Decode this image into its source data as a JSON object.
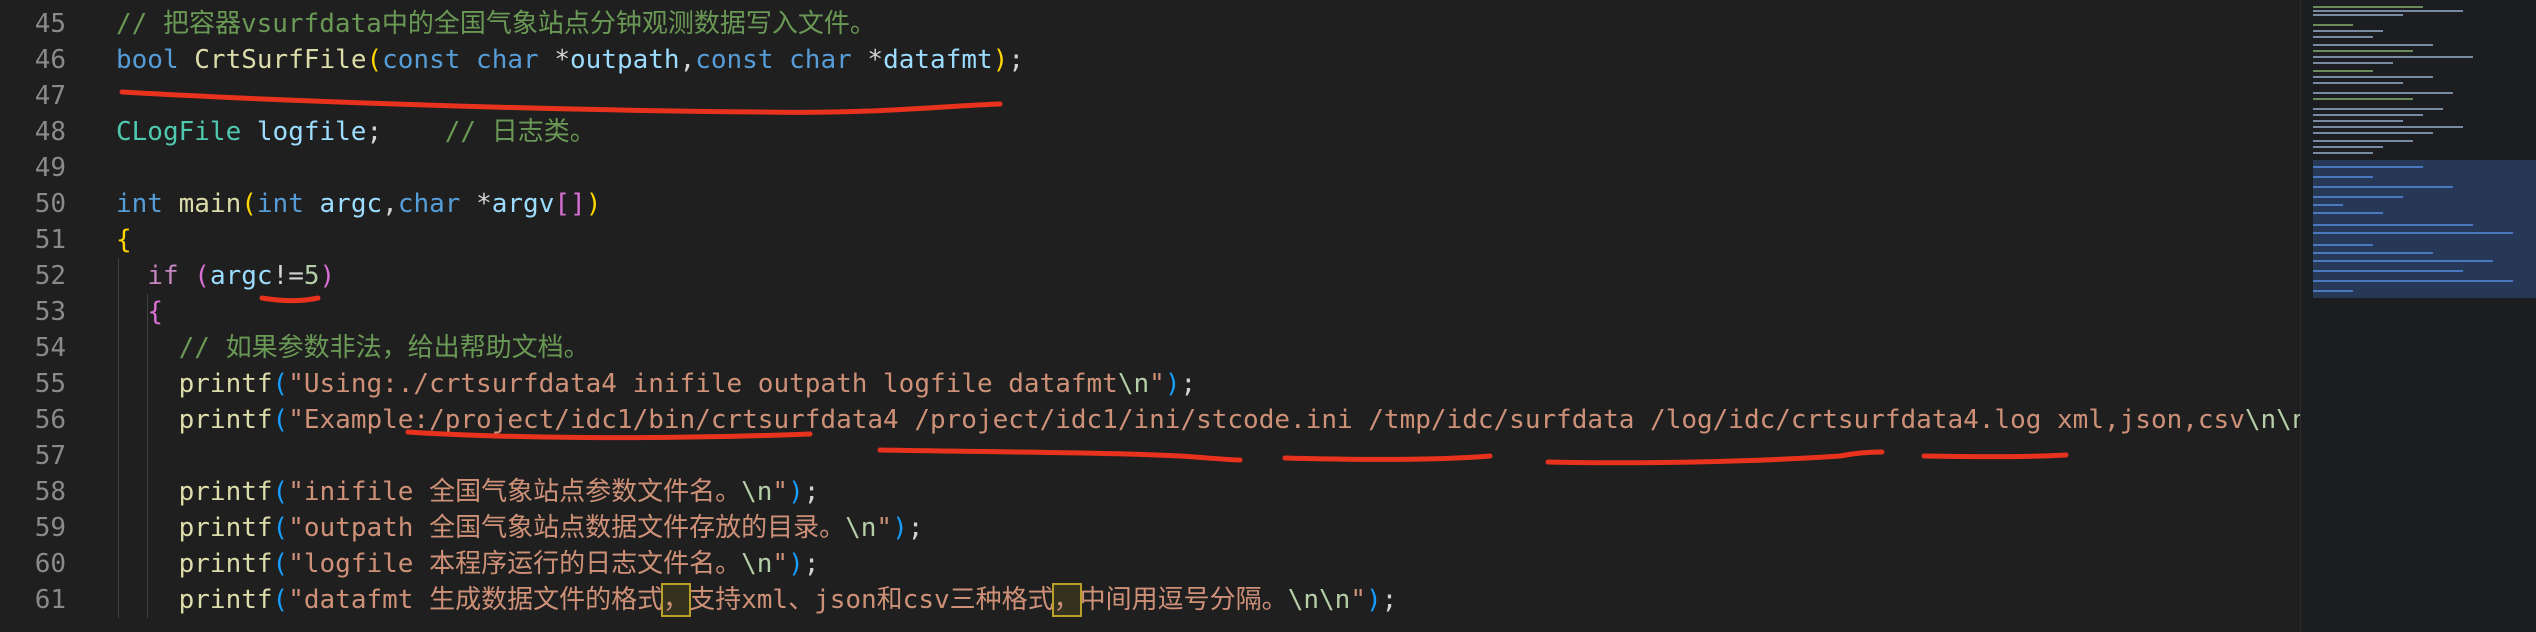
{
  "editor": {
    "lines": [
      {
        "num": "45",
        "tokens": [
          [
            "t-comment",
            "// 把容器vsurfdata中的全国气象站点分钟观测数据写入文件。"
          ]
        ]
      },
      {
        "num": "46",
        "tokens": [
          [
            "t-kw",
            "bool "
          ],
          [
            "t-fn",
            "CrtSurfFile"
          ],
          [
            "t-b1",
            "("
          ],
          [
            "t-kw",
            "const "
          ],
          [
            "t-kw",
            "char "
          ],
          [
            "t-op",
            "*"
          ],
          [
            "t-var",
            "outpath"
          ],
          [
            "t-op",
            ","
          ],
          [
            "t-kw",
            "const "
          ],
          [
            "t-kw",
            "char "
          ],
          [
            "t-op",
            "*"
          ],
          [
            "t-var",
            "datafmt"
          ],
          [
            "t-b1",
            ")"
          ],
          [
            "t-op",
            ";"
          ]
        ]
      },
      {
        "num": "47",
        "tokens": []
      },
      {
        "num": "48",
        "tokens": [
          [
            "t-type",
            "CLogFile "
          ],
          [
            "t-var",
            "logfile"
          ],
          [
            "t-op",
            ";    "
          ],
          [
            "t-comment",
            "// 日志类。"
          ]
        ]
      },
      {
        "num": "49",
        "tokens": []
      },
      {
        "num": "50",
        "tokens": [
          [
            "t-kw",
            "int "
          ],
          [
            "t-fn",
            "main"
          ],
          [
            "t-b1",
            "("
          ],
          [
            "t-kw",
            "int "
          ],
          [
            "t-var",
            "argc"
          ],
          [
            "t-op",
            ","
          ],
          [
            "t-kw",
            "char "
          ],
          [
            "t-op",
            "*"
          ],
          [
            "t-var",
            "argv"
          ],
          [
            "t-b2",
            "[]"
          ],
          [
            "t-b1",
            ")"
          ]
        ]
      },
      {
        "num": "51",
        "tokens": [
          [
            "t-b1",
            "{"
          ]
        ]
      },
      {
        "num": "52",
        "tokens": [
          [
            "t-plain",
            "  "
          ],
          [
            "t-ctl",
            "if "
          ],
          [
            "t-b2",
            "("
          ],
          [
            "t-var",
            "argc"
          ],
          [
            "t-op",
            "!="
          ],
          [
            "t-num",
            "5"
          ],
          [
            "t-b2",
            ")"
          ]
        ]
      },
      {
        "num": "53",
        "tokens": [
          [
            "t-plain",
            "  "
          ],
          [
            "t-b2",
            "{"
          ]
        ]
      },
      {
        "num": "54",
        "tokens": [
          [
            "t-plain",
            "    "
          ],
          [
            "t-comment",
            "// 如果参数非法，给出帮助文档。"
          ]
        ]
      },
      {
        "num": "55",
        "tokens": [
          [
            "t-plain",
            "    "
          ],
          [
            "t-fn",
            "printf"
          ],
          [
            "t-b3",
            "("
          ],
          [
            "t-str",
            "\"Using:./crtsurfdata4 inifile outpath logfile datafmt"
          ],
          [
            "t-num",
            "\\n"
          ],
          [
            "t-str",
            "\""
          ],
          [
            "t-b3",
            ")"
          ],
          [
            "t-op",
            ";"
          ]
        ]
      },
      {
        "num": "56",
        "tokens": [
          [
            "t-plain",
            "    "
          ],
          [
            "t-fn",
            "printf"
          ],
          [
            "t-b3",
            "("
          ],
          [
            "t-str",
            "\"Example:/project/idc1/bin/crtsurfdata4 /project/idc1/ini/stcode.ini /tmp/idc/surfdata /log/idc/crtsurfdata4.log xml,json,csv"
          ],
          [
            "t-num",
            "\\n\\n"
          ],
          [
            "t-str",
            "\""
          ],
          [
            "t-b3",
            ")"
          ],
          [
            "t-op",
            ";"
          ]
        ]
      },
      {
        "num": "57",
        "tokens": []
      },
      {
        "num": "58",
        "tokens": [
          [
            "t-plain",
            "    "
          ],
          [
            "t-fn",
            "printf"
          ],
          [
            "t-b3",
            "("
          ],
          [
            "t-str",
            "\"inifile 全国气象站点参数文件名。"
          ],
          [
            "t-num",
            "\\n"
          ],
          [
            "t-str",
            "\""
          ],
          [
            "t-b3",
            ")"
          ],
          [
            "t-op",
            ";"
          ]
        ]
      },
      {
        "num": "59",
        "tokens": [
          [
            "t-plain",
            "    "
          ],
          [
            "t-fn",
            "printf"
          ],
          [
            "t-b3",
            "("
          ],
          [
            "t-str",
            "\"outpath 全国气象站点数据文件存放的目录。"
          ],
          [
            "t-num",
            "\\n"
          ],
          [
            "t-str",
            "\""
          ],
          [
            "t-b3",
            ")"
          ],
          [
            "t-op",
            ";"
          ]
        ]
      },
      {
        "num": "60",
        "tokens": [
          [
            "t-plain",
            "    "
          ],
          [
            "t-fn",
            "printf"
          ],
          [
            "t-b3",
            "("
          ],
          [
            "t-str",
            "\"logfile 本程序运行的日志文件名。"
          ],
          [
            "t-num",
            "\\n"
          ],
          [
            "t-str",
            "\""
          ],
          [
            "t-b3",
            ")"
          ],
          [
            "t-op",
            ";"
          ]
        ]
      },
      {
        "num": "61",
        "tokens": [
          [
            "t-plain",
            "    "
          ],
          [
            "t-fn",
            "printf"
          ],
          [
            "t-b3",
            "("
          ],
          [
            "t-str",
            "\"datafmt 生成数据文件的格式"
          ],
          [
            "t-str hl",
            "，"
          ],
          [
            "t-str",
            "支持xml、json和csv三种格式"
          ],
          [
            "t-str hl",
            "，"
          ],
          [
            "t-str",
            "中间用逗号分隔。"
          ],
          [
            "t-num",
            "\\n\\n"
          ],
          [
            "t-str",
            "\""
          ],
          [
            "t-b3",
            ")"
          ],
          [
            "t-op",
            ";"
          ]
        ]
      }
    ]
  },
  "colors": {
    "background": "#1f1f1f",
    "annotation": "#e8321e"
  }
}
